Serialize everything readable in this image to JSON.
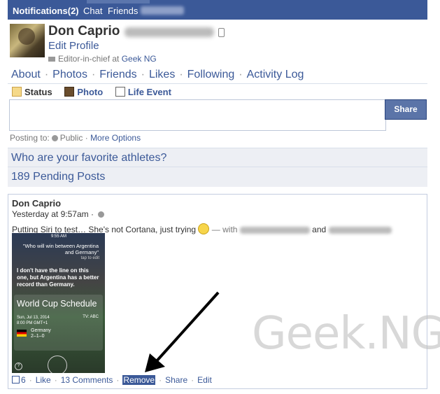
{
  "topbar": {
    "notifications": "Notifications",
    "notifications_count": "(2)",
    "chat": "Chat",
    "friends": "Friends"
  },
  "profile": {
    "name": "Don Caprio",
    "edit_profile": "Edit Profile",
    "job_role": "Editor-in-chief at",
    "job_company": "Geek NG"
  },
  "nav": {
    "items": [
      "About",
      "Photos",
      "Friends",
      "Likes",
      "Following",
      "Activity Log"
    ]
  },
  "composer": {
    "tabs": [
      "Status",
      "Photo",
      "Life Event"
    ],
    "share_label": "Share",
    "posting_to_label": "Posting to:",
    "privacy": "Public",
    "more_options": "More Options"
  },
  "prompts": {
    "question": "Who are your favorite athletes?",
    "pending": "189 Pending Posts"
  },
  "post": {
    "author": "Don Caprio",
    "time": "Yesterday at 9:57am",
    "text": "Putting Siri to test… She's not Cortana, just trying",
    "with_label": "— with",
    "and_label": "and",
    "screenshot": {
      "clock": "9:55 AM",
      "question": "\"Who will win between Argentina and Germany\"",
      "tap": "tap to edit",
      "answer": "I don't have the line on this one, but Argentina has a better record than Germany.",
      "card_title": "World Cup Schedule",
      "date": "Sun, Jul 13, 2014",
      "kickoff": "8:00 PM GMT+1",
      "tv": "TV: ABC",
      "team": "Germany",
      "record": "2–1–0"
    },
    "likes": "6",
    "actions": [
      "Like",
      "13 Comments",
      "Remove",
      "Share",
      "Edit"
    ]
  },
  "watermark": "Geek.NG"
}
